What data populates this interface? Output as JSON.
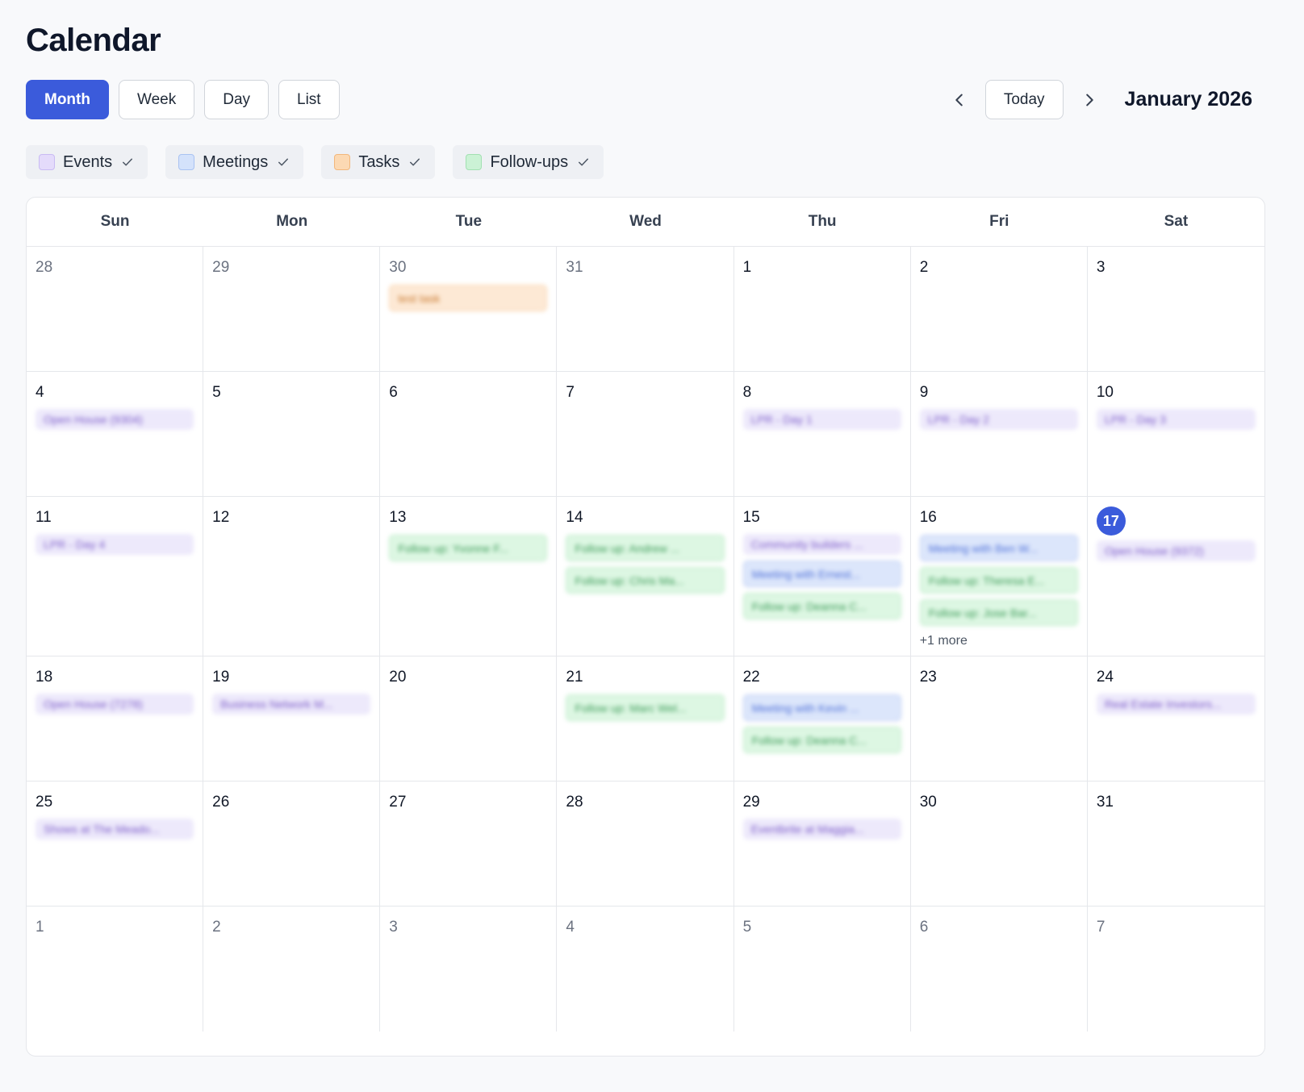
{
  "header": {
    "title": "Calendar"
  },
  "views": [
    {
      "label": "Month",
      "active": true
    },
    {
      "label": "Week",
      "active": false
    },
    {
      "label": "Day",
      "active": false
    },
    {
      "label": "List",
      "active": false
    }
  ],
  "nav": {
    "prev_icon": "chevron-left-icon",
    "today_label": "Today",
    "next_icon": "chevron-right-icon",
    "month_label": "January 2026"
  },
  "filters": [
    {
      "label": "Events",
      "color": "#e4dbfb",
      "border": "#c9bbf3",
      "checked": true
    },
    {
      "label": "Meetings",
      "color": "#d4e2fb",
      "border": "#a9c3f2",
      "checked": true
    },
    {
      "label": "Tasks",
      "color": "#fcd9b3",
      "border": "#f2b77c",
      "checked": true
    },
    {
      "label": "Follow-ups",
      "color": "#cbf2d5",
      "border": "#a2e0b2",
      "checked": true
    }
  ],
  "weekdays": [
    "Sun",
    "Mon",
    "Tue",
    "Wed",
    "Thu",
    "Fri",
    "Sat"
  ],
  "weeks": [
    {
      "days": [
        {
          "num": "28",
          "muted": true,
          "events": []
        },
        {
          "num": "29",
          "muted": true,
          "events": []
        },
        {
          "num": "30",
          "muted": true,
          "events": [
            {
              "type": "task",
              "title": "test task"
            }
          ]
        },
        {
          "num": "31",
          "muted": true,
          "events": []
        },
        {
          "num": "1",
          "events": []
        },
        {
          "num": "2",
          "events": []
        },
        {
          "num": "3",
          "events": []
        }
      ]
    },
    {
      "days": [
        {
          "num": "4",
          "events": [
            {
              "type": "event",
              "title": "Open House (9304)"
            }
          ]
        },
        {
          "num": "5",
          "events": []
        },
        {
          "num": "6",
          "events": []
        },
        {
          "num": "7",
          "events": []
        },
        {
          "num": "8",
          "events": [
            {
              "type": "event",
              "title": "LPR - Day 1"
            }
          ]
        },
        {
          "num": "9",
          "events": [
            {
              "type": "event",
              "title": "LPR - Day 2"
            }
          ]
        },
        {
          "num": "10",
          "events": [
            {
              "type": "event",
              "title": "LPR - Day 3"
            }
          ]
        }
      ]
    },
    {
      "days": [
        {
          "num": "11",
          "events": [
            {
              "type": "event",
              "title": "LPR - Day 4"
            }
          ]
        },
        {
          "num": "12",
          "events": []
        },
        {
          "num": "13",
          "events": [
            {
              "type": "followup",
              "title": "Follow up: Yvonne F..."
            }
          ]
        },
        {
          "num": "14",
          "events": [
            {
              "type": "followup",
              "title": "Follow up: Andrew ..."
            },
            {
              "type": "followup",
              "title": "Follow up: Chris Ma..."
            }
          ]
        },
        {
          "num": "15",
          "events": [
            {
              "type": "event",
              "title": "Community builders ..."
            },
            {
              "type": "meeting",
              "title": "Meeting with Ernest..."
            },
            {
              "type": "followup",
              "title": "Follow up: Deanna C..."
            }
          ]
        },
        {
          "num": "16",
          "events": [
            {
              "type": "meeting",
              "title": "Meeting with Ben W..."
            },
            {
              "type": "followup",
              "title": "Follow up: Theresa E..."
            },
            {
              "type": "followup",
              "title": "Follow up: Jose Bar..."
            }
          ],
          "more": "+1 more"
        },
        {
          "num": "17",
          "today": true,
          "events": [
            {
              "type": "event",
              "title": "Open House (9372)"
            }
          ]
        }
      ]
    },
    {
      "days": [
        {
          "num": "18",
          "events": [
            {
              "type": "event",
              "title": "Open House (7278)"
            }
          ]
        },
        {
          "num": "19",
          "events": [
            {
              "type": "event",
              "title": "Business Network M..."
            }
          ]
        },
        {
          "num": "20",
          "events": []
        },
        {
          "num": "21",
          "events": [
            {
              "type": "followup",
              "title": "Follow up: Marc Wel..."
            }
          ]
        },
        {
          "num": "22",
          "events": [
            {
              "type": "meeting",
              "title": "Meeting with Kevin ..."
            },
            {
              "type": "followup",
              "title": "Follow up: Deanna C..."
            }
          ]
        },
        {
          "num": "23",
          "events": []
        },
        {
          "num": "24",
          "events": [
            {
              "type": "event",
              "title": "Real Estate Investors..."
            }
          ]
        }
      ]
    },
    {
      "days": [
        {
          "num": "25",
          "events": [
            {
              "type": "event",
              "title": "Shows at The Meado..."
            }
          ]
        },
        {
          "num": "26",
          "events": []
        },
        {
          "num": "27",
          "events": []
        },
        {
          "num": "28",
          "events": []
        },
        {
          "num": "29",
          "events": [
            {
              "type": "event",
              "title": "Eventbrite at Maggia..."
            }
          ]
        },
        {
          "num": "30",
          "events": []
        },
        {
          "num": "31",
          "events": []
        }
      ]
    },
    {
      "days": [
        {
          "num": "1",
          "muted": true,
          "events": []
        },
        {
          "num": "2",
          "muted": true,
          "events": []
        },
        {
          "num": "3",
          "muted": true,
          "events": []
        },
        {
          "num": "4",
          "muted": true,
          "events": []
        },
        {
          "num": "5",
          "muted": true,
          "events": []
        },
        {
          "num": "6",
          "muted": true,
          "events": []
        },
        {
          "num": "7",
          "muted": true,
          "events": []
        }
      ]
    }
  ]
}
